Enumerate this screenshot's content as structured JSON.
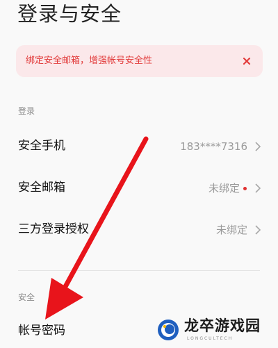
{
  "page": {
    "title": "登录与安全"
  },
  "banner": {
    "text": "绑定安全邮箱，增强帐号安全性",
    "accent_color": "#e23b3b",
    "background_color": "#fbe8ea",
    "close_icon": "close-icon"
  },
  "sections": {
    "login": {
      "label": "登录",
      "rows": [
        {
          "label": "安全手机",
          "value": "183****7316",
          "has_dot": false
        },
        {
          "label": "安全邮箱",
          "value": "未绑定",
          "has_dot": true
        },
        {
          "label": "三方登录授权",
          "value": "未绑定",
          "has_dot": false
        }
      ]
    },
    "security": {
      "label": "安全",
      "rows": [
        {
          "label": "帐号密码"
        }
      ]
    }
  },
  "annotation": {
    "type": "red-arrow",
    "color": "#e8141b",
    "points_to": "帐号密码"
  },
  "watermark": {
    "brand": "龙卒游戏园",
    "sub": "LONGCULTECH"
  }
}
